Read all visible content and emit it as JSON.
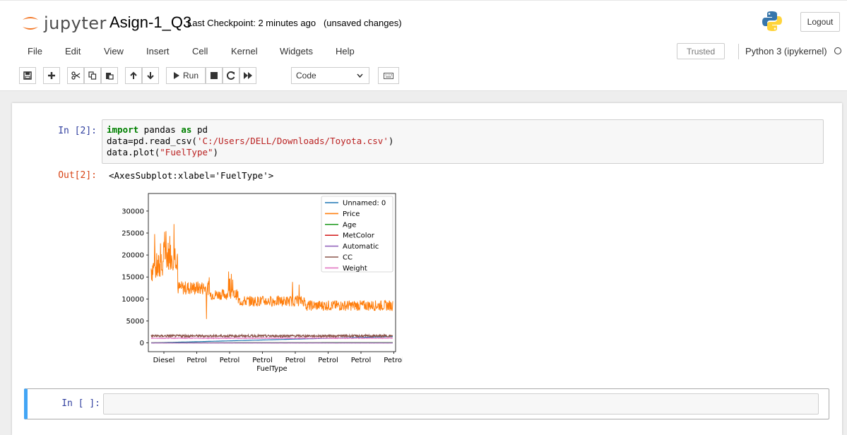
{
  "header": {
    "logo_text": "jupyter",
    "notebook_name": "Asign-1_Q3",
    "checkpoint_text": "Last Checkpoint: 2 minutes ago",
    "unsaved_text": "(unsaved changes)",
    "logout_label": "Logout"
  },
  "menu": {
    "items": [
      "File",
      "Edit",
      "View",
      "Insert",
      "Cell",
      "Kernel",
      "Widgets",
      "Help"
    ],
    "trusted_label": "Trusted",
    "kernel_name": "Python 3 (ipykernel)"
  },
  "toolbar": {
    "run_label": "Run",
    "cell_type": "Code",
    "icons": [
      "save-icon",
      "plus-icon",
      "cut-icon",
      "copy-icon",
      "paste-icon",
      "arrow-up-icon",
      "arrow-down-icon",
      "run-icon",
      "stop-icon",
      "restart-icon",
      "fast-forward-icon",
      "keyboard-icon"
    ]
  },
  "cells": {
    "cell1": {
      "prompt": "In [2]:",
      "line1_kw1": "import",
      "line1_mid": " pandas ",
      "line1_kw2": "as",
      "line1_end": " pd",
      "line2_start": "data=pd.read_csv(",
      "line2_str": "'C:/Users/DELL/Downloads/Toyota.csv'",
      "line2_end": ")",
      "line3_start": "data.plot(",
      "line3_str": "\"FuelType\"",
      "line3_end": ")",
      "out_prompt": "Out[2]:",
      "out_text": "<AxesSubplot:xlabel='FuelType'>"
    },
    "cell2": {
      "prompt": "In [ ]:"
    }
  },
  "chart_data": {
    "type": "line",
    "xlabel": "FuelType",
    "x_tick_labels": [
      "Diesel",
      "Petrol",
      "Petrol",
      "Petrol",
      "Petrol",
      "Petrol",
      "Petrol",
      "Petrol"
    ],
    "y_ticks": [
      0,
      5000,
      10000,
      15000,
      20000,
      25000,
      30000
    ],
    "ylim": [
      -2000,
      34000
    ],
    "n_points": 1436,
    "legend_position": "upper right",
    "series": [
      {
        "name": "Unnamed: 0",
        "color": "#1f77b4",
        "start": 0,
        "end": 1435
      },
      {
        "name": "Price",
        "color": "#ff7f0e",
        "approx_levels": [
          {
            "range": [
              0,
              0.05
            ],
            "value": 17000
          },
          {
            "range": [
              0.05,
              0.11
            ],
            "value": 20000
          },
          {
            "range": [
              0.11,
              0.24
            ],
            "value": 12500
          },
          {
            "range": [
              0.24,
              0.36
            ],
            "value": 11000
          },
          {
            "range": [
              0.36,
              0.64
            ],
            "value": 9500
          },
          {
            "range": [
              0.64,
              0.99
            ],
            "value": 8500
          }
        ],
        "max": 32500,
        "min": 4350
      },
      {
        "name": "Age",
        "color": "#2ca02c",
        "approx": 56
      },
      {
        "name": "MetColor",
        "color": "#d62728",
        "approx": 1
      },
      {
        "name": "Automatic",
        "color": "#9467bd",
        "approx": 0
      },
      {
        "name": "CC",
        "color": "#8c564b",
        "approx": 1580
      },
      {
        "name": "Weight",
        "color": "#e377c2",
        "approx": 1070
      }
    ]
  }
}
